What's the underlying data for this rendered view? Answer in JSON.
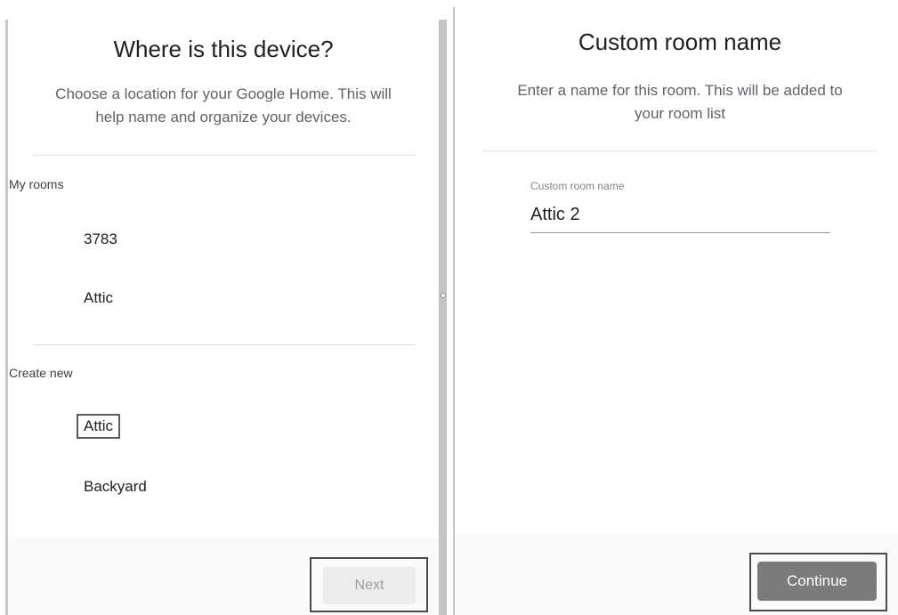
{
  "left_panel": {
    "title": "Where is this device?",
    "subtitle_line1": "Choose a location for your Google Home. This will",
    "subtitle_line2": "help name and organize your devices.",
    "my_rooms_label": "My rooms",
    "my_rooms": [
      "3783",
      "Attic"
    ],
    "create_new_label": "Create new",
    "create_new": [
      "Attic",
      "Backyard"
    ],
    "next_button": "Next"
  },
  "right_panel": {
    "title": "Custom room name",
    "subtitle_line1": "Enter a name for this room. This will be added to",
    "subtitle_line2": "your room list",
    "field_label": "Custom room name",
    "field_value": "Attic 2",
    "continue_button": "Continue"
  }
}
